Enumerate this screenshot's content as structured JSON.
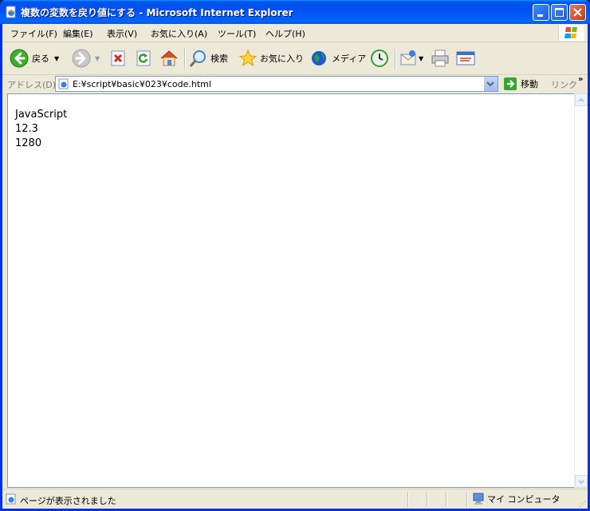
{
  "window": {
    "title": "複数の変数を戻り値にする - Microsoft Internet Explorer"
  },
  "menubar": {
    "items": [
      "ファイル(F)",
      "編集(E)",
      "表示(V)",
      "お気に入り(A)",
      "ツール(T)",
      "ヘルプ(H)"
    ]
  },
  "toolbar": {
    "back_label": "戻る",
    "search_label": "検索",
    "favorites_label": "お気に入り",
    "media_label": "メディア"
  },
  "addressbar": {
    "label": "アドレス(D)",
    "url": "E:¥script¥basic¥023¥code.html",
    "go_label": "移動",
    "links_label": "リンク"
  },
  "content": {
    "lines": [
      "JavaScript",
      "12.3",
      "1280"
    ]
  },
  "statusbar": {
    "text": "ページが表示されました",
    "zone": "マイ コンピュータ"
  },
  "colors": {
    "titlebar": "#0054e3",
    "chrome": "#ece9d8",
    "page_bg": "#ffffff"
  }
}
